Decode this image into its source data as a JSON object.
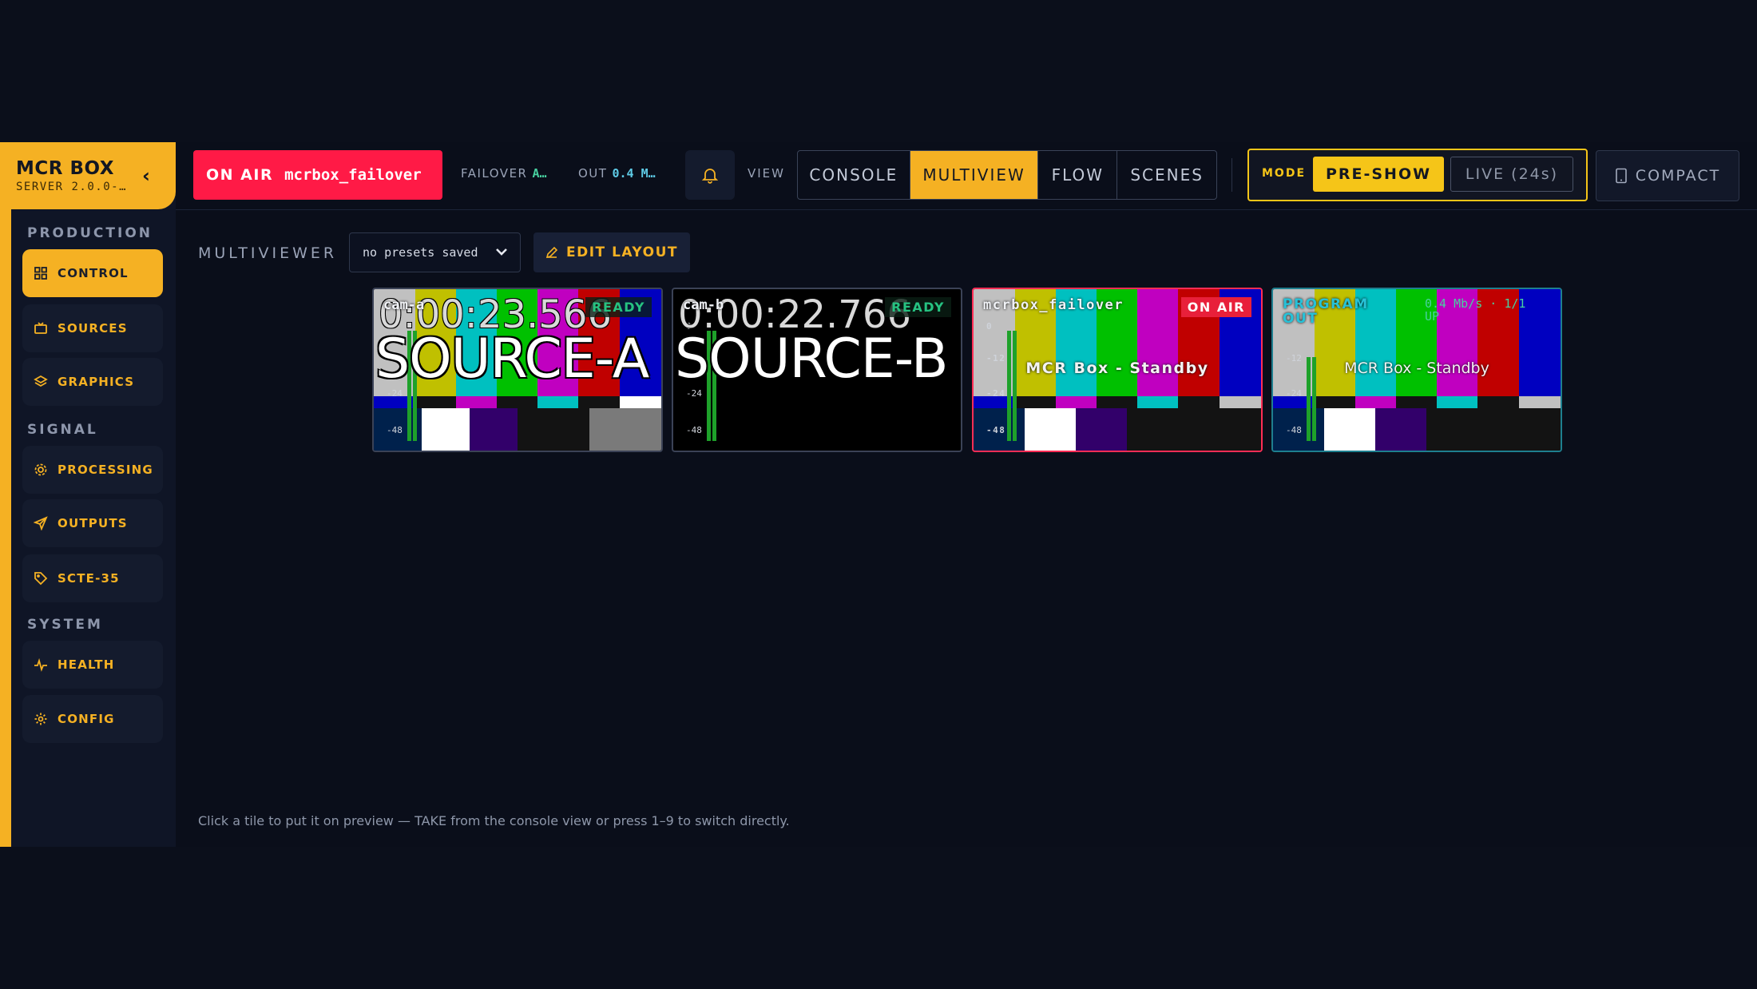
{
  "brand": {
    "name": "MCR BOX",
    "version": "SERVER 2.0.0-…",
    "collapse": "‹"
  },
  "sidebar": {
    "sections": [
      {
        "title": "PRODUCTION"
      },
      {
        "title": "SIGNAL"
      },
      {
        "title": "SYSTEM"
      }
    ],
    "items": [
      {
        "label": "CONTROL",
        "icon": "grid-icon"
      },
      {
        "label": "SOURCES",
        "icon": "tv-icon"
      },
      {
        "label": "GRAPHICS",
        "icon": "layers-icon"
      },
      {
        "label": "PROCESSING",
        "icon": "chip-icon"
      },
      {
        "label": "OUTPUTS",
        "icon": "send-icon"
      },
      {
        "label": "SCTE-35",
        "icon": "tag-icon"
      },
      {
        "label": "HEALTH",
        "icon": "pulse-icon"
      },
      {
        "label": "CONFIG",
        "icon": "gear-icon"
      }
    ]
  },
  "topbar": {
    "onair_label": "ON AIR",
    "onair_source": "mcrbox_failover",
    "failover_label": "FAILOVER",
    "failover_value": "A…",
    "out_label": "OUT",
    "out_value": "0.4 M…",
    "view_label": "VIEW",
    "views": [
      "CONSOLE",
      "MULTIVIEW",
      "FLOW",
      "SCENES"
    ],
    "active_view": "MULTIVIEW",
    "mode_label": "MODE",
    "mode_preshow": "PRE-SHOW",
    "mode_live": "LIVE (24s)",
    "compact_label": "COMPACT"
  },
  "main": {
    "title": "MULTIVIEWER",
    "presets_value": "no presets saved",
    "edit_layout": "EDIT LAYOUT",
    "hint": "Click a tile to put it on preview — TAKE from the console view or press 1–9 to switch directly."
  },
  "meter_scale": [
    "0",
    "-12",
    "-24",
    "-48"
  ],
  "tiles": [
    {
      "name": "cam-a",
      "status": "READY",
      "timecode": "0:00:23.566",
      "overlay": "SOURCE-A"
    },
    {
      "name": "cam-b",
      "status": "READY",
      "timecode": "0:00:22.766",
      "overlay": "SOURCE-B"
    },
    {
      "name": "mcrbox_failover",
      "status": "ON AIR",
      "caption": "MCR Box - Standby"
    },
    {
      "name": "PROGRAM OUT",
      "rate": "0.4 Mb/s · 1/1",
      "rate_sub": "UP",
      "caption": "MCR Box - Standby"
    }
  ],
  "colors": {
    "accent": "#f5b123",
    "onair": "#ff1a46",
    "ready": "#26c281",
    "program": "#27c2d8",
    "mode": "#f5c518"
  }
}
